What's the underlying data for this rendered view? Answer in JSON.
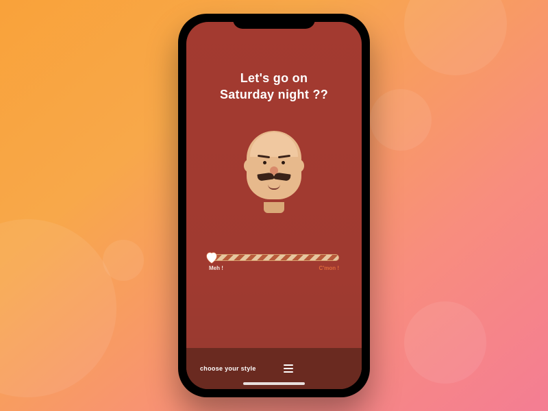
{
  "title_line1": "Let's go on",
  "title_line2": "Saturday night ??",
  "slider": {
    "left_label": "Meh !",
    "right_label": "C'mon !"
  },
  "footer": {
    "label": "choose your style"
  }
}
